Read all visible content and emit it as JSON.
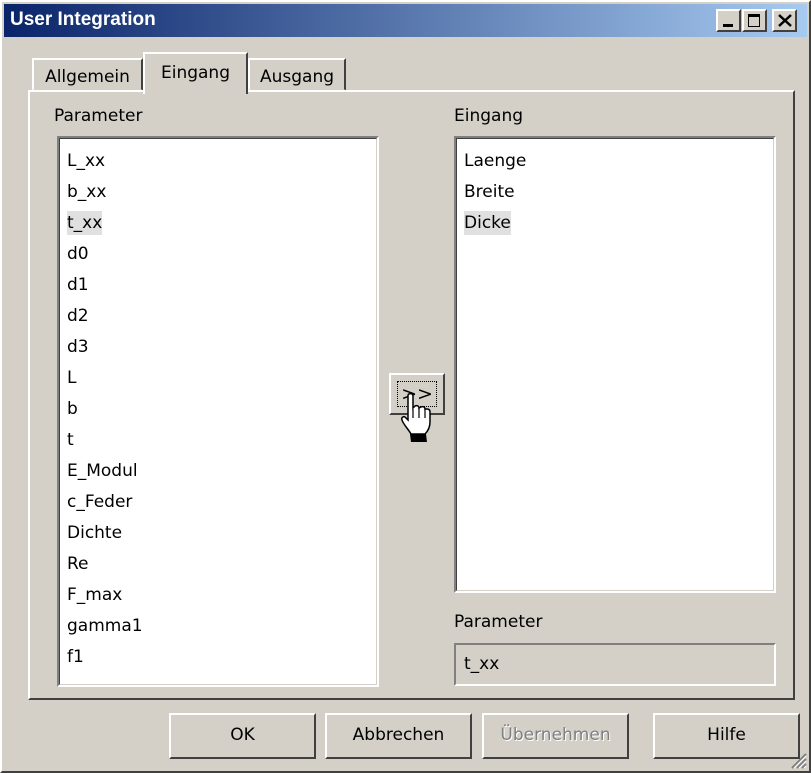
{
  "window": {
    "title": "User Integration"
  },
  "tabs": [
    {
      "label": "Allgemein",
      "active": false
    },
    {
      "label": "Eingang",
      "active": true
    },
    {
      "label": "Ausgang",
      "active": false
    }
  ],
  "left_list": {
    "label": "Parameter",
    "items": [
      "L_xx",
      "b_xx",
      "t_xx",
      "d0",
      "d1",
      "d2",
      "d3",
      "L",
      "b",
      "t",
      "E_Modul",
      "c_Feder",
      "Dichte",
      "Re",
      "F_max",
      "gamma1",
      "f1"
    ],
    "selected": "t_xx"
  },
  "move_button": {
    "label": ">>"
  },
  "right_list": {
    "label": "Eingang",
    "items": [
      "Laenge",
      "Breite",
      "Dicke"
    ],
    "selected": "Dicke"
  },
  "parameter_field": {
    "label": "Parameter",
    "value": "t_xx"
  },
  "buttons": {
    "ok": "OK",
    "cancel": "Abbrechen",
    "apply": "Übernehmen",
    "help": "Hilfe"
  },
  "icons": [
    "minimize-icon",
    "maximize-icon",
    "close-icon",
    "hand-cursor-icon",
    "resize-grip-icon"
  ]
}
